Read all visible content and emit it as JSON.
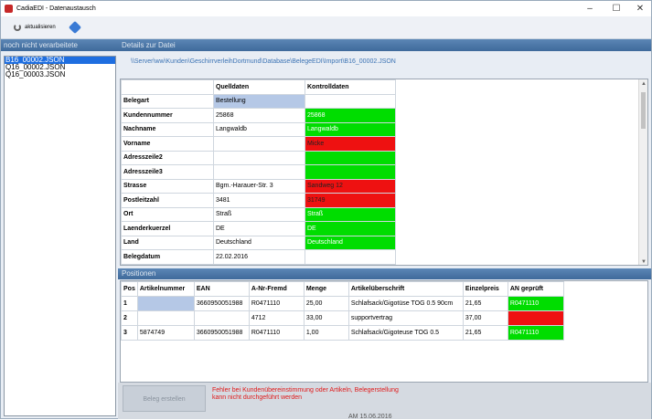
{
  "window": {
    "title": "CadiaEDI - Datenaustausch"
  },
  "toolbar": {
    "refresh_label": "aktualisieren"
  },
  "left": {
    "header": "noch nicht verarbeitete",
    "files": [
      "B16_00002.JSON",
      "Q16_00002.JSON",
      "Q16_00003.JSON"
    ],
    "selected_index": 0
  },
  "details": {
    "header": "Details zur Datei",
    "path": "\\\\Server\\ww\\Kunden\\GeschirrverleihDortmund\\Database\\BelegeEDI\\Import\\B16_00002.JSON",
    "col_source": "Quelldaten",
    "col_check": "Kontrolldaten",
    "rows": [
      {
        "label": "Belegart",
        "source": "Bestellung",
        "check": "",
        "source_style": "b",
        "check_style": ""
      },
      {
        "label": "Kundennummer",
        "source": "25868",
        "check": "25868",
        "source_style": "",
        "check_style": "g"
      },
      {
        "label": "Nachname",
        "source": "Langwaldb",
        "check": "Langwaldb",
        "source_style": "",
        "check_style": "g"
      },
      {
        "label": "Vorname",
        "source": "",
        "check": "Micke",
        "source_style": "",
        "check_style": "r"
      },
      {
        "label": "Adresszeile2",
        "source": "",
        "check": "",
        "source_style": "",
        "check_style": "g"
      },
      {
        "label": "Adresszeile3",
        "source": "",
        "check": "",
        "source_style": "",
        "check_style": "g"
      },
      {
        "label": "Strasse",
        "source": "Bgm.-Harauer-Str. 3",
        "check": "Sandweg 12",
        "source_style": "",
        "check_style": "r"
      },
      {
        "label": "Postleitzahl",
        "source": "3481",
        "check": "31749",
        "source_style": "",
        "check_style": "r"
      },
      {
        "label": "Ort",
        "source": "Straß",
        "check": "Straß",
        "source_style": "",
        "check_style": "g"
      },
      {
        "label": "Laenderkuerzel",
        "source": "DE",
        "check": "DE",
        "source_style": "",
        "check_style": "g"
      },
      {
        "label": "Land",
        "source": "Deutschland",
        "check": "Deutschland",
        "source_style": "",
        "check_style": "g"
      },
      {
        "label": "Belegdatum",
        "source": "22.02.2016",
        "check": "",
        "source_style": "",
        "check_style": ""
      }
    ]
  },
  "positions": {
    "header": "Positionen",
    "columns": [
      "Pos",
      "Artikelnummer",
      "EAN",
      "A-Nr-Fremd",
      "Menge",
      "Artikelüberschrift",
      "Einzelpreis",
      "AN geprüft"
    ],
    "rows": [
      {
        "pos": "1",
        "artnr": "",
        "ean": "3660950051988",
        "fremd": "R0471110",
        "menge": "25,00",
        "titel": "Schlafsack/Gigotüse TOG 0.5  90cm",
        "preis": "21,65",
        "geprueft": "R0471110",
        "artnr_style": "b",
        "geprueft_style": "g"
      },
      {
        "pos": "2",
        "artnr": "",
        "ean": "",
        "fremd": "4712",
        "menge": "33,00",
        "titel": "supportvertrag",
        "preis": "37,00",
        "geprueft": "",
        "artnr_style": "",
        "geprueft_style": "r"
      },
      {
        "pos": "3",
        "artnr": "5874749",
        "ean": "3660950051988",
        "fremd": "R0471110",
        "menge": "1,00",
        "titel": "Schlafsack/Gigoteuse TOG 0.5",
        "preis": "21,65",
        "geprueft": "R0471110",
        "artnr_style": "",
        "geprueft_style": "g"
      }
    ]
  },
  "footer": {
    "create_button": "Beleg erstellen",
    "error_line1": "Fehler bei Kundenübereinstimmung oder Artikeln, Belegerstellung",
    "error_line2": "kann nicht durchgeführt werden",
    "background_text": "AM 15.06.2016"
  }
}
